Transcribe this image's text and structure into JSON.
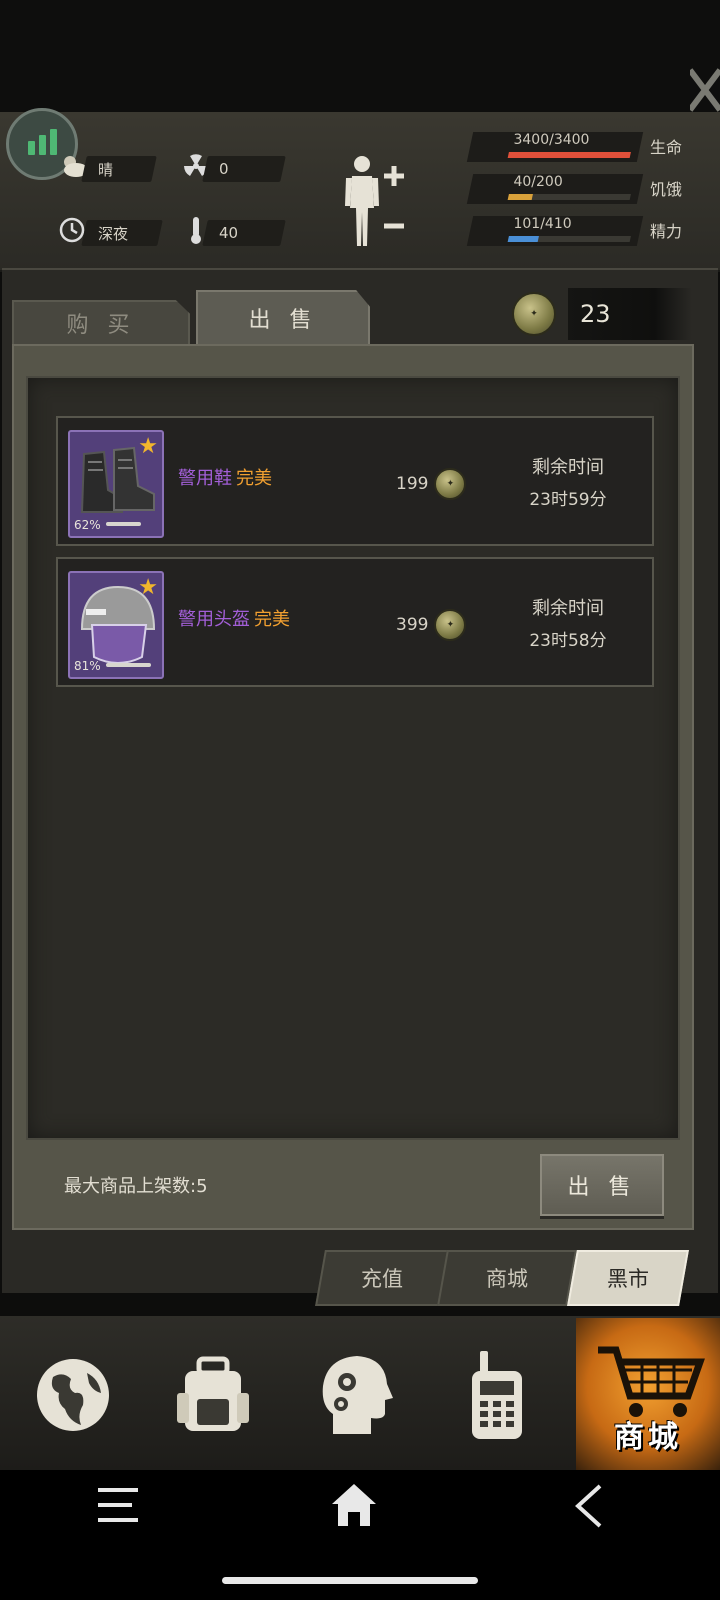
{
  "hud": {
    "weather": "晴",
    "radiation": "0",
    "time_of_day": "深夜",
    "temperature": "40",
    "vitals": [
      {
        "name": "生命",
        "value": "3400/3400",
        "fill": 1.0,
        "color": "#e0503a",
        "icon": "heart-pulse-icon"
      },
      {
        "name": "饥饿",
        "value": "40/200",
        "fill": 0.2,
        "color": "#d9a13a",
        "icon": "stomach-icon"
      },
      {
        "name": "精力",
        "value": "101/410",
        "fill": 0.246,
        "color": "#4a8fd6",
        "icon": "energy-icon"
      }
    ]
  },
  "tabs": {
    "buy": "购 买",
    "sell": "出 售"
  },
  "currency": {
    "amount": "23",
    "icon": "bottle-cap-coin-icon"
  },
  "listings": [
    {
      "name": "警用鞋",
      "quality": "完美",
      "durability": "62%",
      "durability_fill": 0.62,
      "price": "199",
      "remain_label": "剩余时间",
      "remain_time": "23时59分",
      "icon": "police-boots-icon"
    },
    {
      "name": "警用头盔",
      "quality": "完美",
      "durability": "81%",
      "durability_fill": 0.81,
      "price": "399",
      "remain_label": "剩余时间",
      "remain_time": "23时58分",
      "icon": "police-helmet-icon"
    }
  ],
  "footer": {
    "max_label": "最大商品上架数:5",
    "sell_button": "出 售"
  },
  "subtabs": [
    "充值",
    "商城",
    "黑市"
  ],
  "subtab_active": "黑市",
  "bottom_nav": [
    {
      "name": "world",
      "icon": "globe-icon"
    },
    {
      "name": "inventory",
      "icon": "backpack-icon"
    },
    {
      "name": "skills",
      "icon": "head-gears-icon"
    },
    {
      "name": "radio",
      "icon": "walkie-talkie-icon"
    },
    {
      "name": "shop",
      "icon": "shopping-cart-icon",
      "label": "商城"
    }
  ],
  "colors": {
    "item_name": "#a35fd8",
    "quality_perfect": "#f2a030",
    "shop_accent": "#f2a030"
  }
}
